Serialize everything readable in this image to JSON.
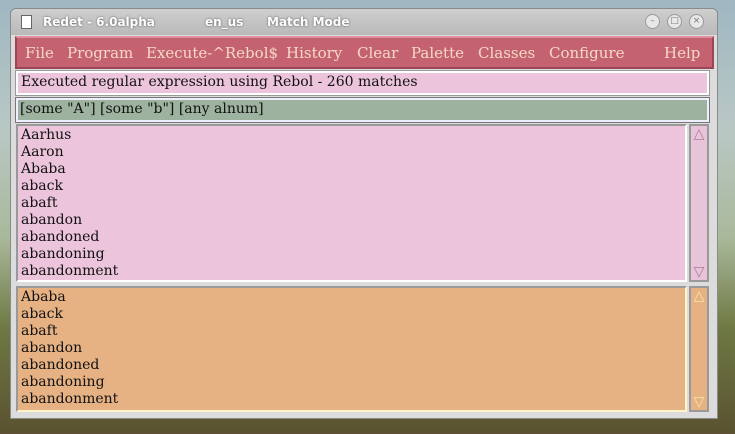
{
  "window": {
    "title": "Redet - 6.0alpha",
    "locale": "en_us",
    "mode": "Match Mode",
    "controls": [
      "minimize",
      "maximize",
      "close"
    ]
  },
  "menu": [
    "File",
    "Program",
    "Execute-^Rebol$",
    "History",
    "Clear",
    "Palette",
    "Classes",
    "Configure",
    "Help"
  ],
  "status": "Executed regular expression using Rebol - 260 matches",
  "regex": "[some \"A\"] [some \"b\"] [any alnum]",
  "input_list": [
    "Aarhus",
    "Aaron",
    "Ababa",
    "aback",
    "abaft",
    "abandon",
    "abandoned",
    "abandoning",
    "abandonment"
  ],
  "match_list": [
    "Ababa",
    "aback",
    "abaft",
    "abandon",
    "abandoned",
    "abandoning",
    "abandonment"
  ],
  "colors": {
    "menu": "#c46272",
    "status": "#ecc4dc",
    "regex": "#9db3a0",
    "input_list": "#ecc4dc",
    "match_list": "#e6b283"
  }
}
